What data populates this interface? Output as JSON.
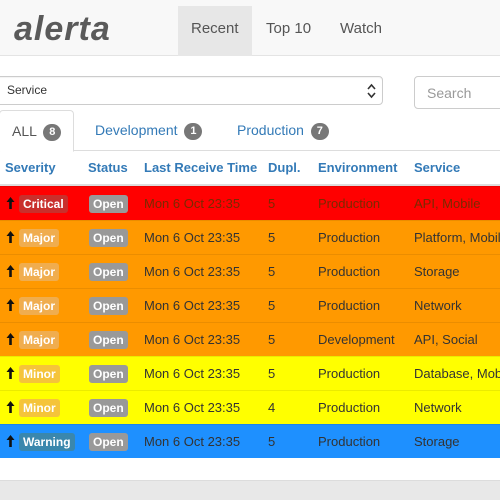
{
  "navbar": {
    "brand": "alerta",
    "items": [
      {
        "label": "Recent",
        "active": true
      },
      {
        "label": "Top 10",
        "active": false
      },
      {
        "label": "Watch",
        "active": false
      }
    ]
  },
  "filter": {
    "select_value": "Service",
    "search_placeholder": "Search"
  },
  "tabs": [
    {
      "label": "ALL",
      "count": "8",
      "active": true
    },
    {
      "label": "Development",
      "count": "1",
      "active": false
    },
    {
      "label": "Production",
      "count": "7",
      "active": false
    }
  ],
  "table": {
    "columns": [
      "Severity",
      "Status",
      "Last Receive Time",
      "Dupl.",
      "Environment",
      "Service"
    ],
    "rows": [
      {
        "severity": "Critical",
        "status": "Open",
        "time": "Mon 6 Oct 23:35",
        "dupl": "5",
        "environment": "Production",
        "service": "API, Mobile",
        "row_color": "#ff0000",
        "label_color": "#c9302c"
      },
      {
        "severity": "Major",
        "status": "Open",
        "time": "Mon 6 Oct 23:35",
        "dupl": "5",
        "environment": "Production",
        "service": "Platform, Mobile",
        "row_color": "#ff9900",
        "label_color": "#f0ad4e"
      },
      {
        "severity": "Major",
        "status": "Open",
        "time": "Mon 6 Oct 23:35",
        "dupl": "5",
        "environment": "Production",
        "service": "Storage",
        "row_color": "#ff9900",
        "label_color": "#f0ad4e"
      },
      {
        "severity": "Major",
        "status": "Open",
        "time": "Mon 6 Oct 23:35",
        "dupl": "5",
        "environment": "Production",
        "service": "Network",
        "row_color": "#ff9900",
        "label_color": "#f0ad4e"
      },
      {
        "severity": "Major",
        "status": "Open",
        "time": "Mon 6 Oct 23:35",
        "dupl": "5",
        "environment": "Development",
        "service": "API, Social",
        "row_color": "#ff9900",
        "label_color": "#f0ad4e"
      },
      {
        "severity": "Minor",
        "status": "Open",
        "time": "Mon 6 Oct 23:35",
        "dupl": "5",
        "environment": "Production",
        "service": "Database, Mobile",
        "row_color": "#ffff00",
        "label_color": "#f5c43a"
      },
      {
        "severity": "Minor",
        "status": "Open",
        "time": "Mon 6 Oct 23:35",
        "dupl": "4",
        "environment": "Production",
        "service": "Network",
        "row_color": "#ffff00",
        "label_color": "#f5c43a"
      },
      {
        "severity": "Warning",
        "status": "Open",
        "time": "Mon 6 Oct 23:35",
        "dupl": "5",
        "environment": "Production",
        "service": "Storage",
        "row_color": "#1e90ff",
        "label_color": "#3a87ad"
      }
    ]
  },
  "colors": {
    "link": "#337ab7",
    "status_label": "#999999",
    "count_badge": "#777777"
  }
}
